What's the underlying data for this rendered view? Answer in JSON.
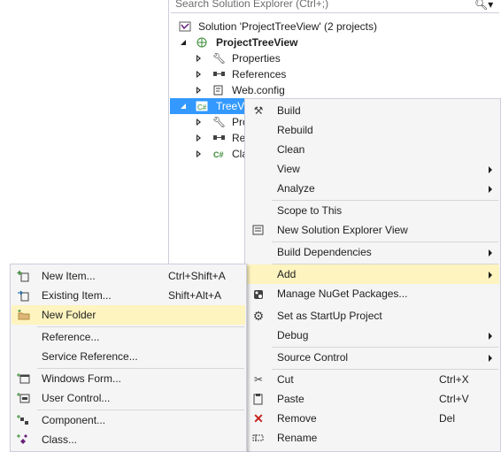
{
  "search": {
    "placeholder": "Search Solution Explorer (Ctrl+;)"
  },
  "tree": {
    "solution": "Solution 'ProjectTreeView' (2 projects)",
    "project": "ProjectTreeView",
    "items": [
      "Properties",
      "References",
      "Web.config"
    ],
    "selected": "TreeV",
    "sub_items": [
      "Pro",
      "Re",
      "Cla"
    ]
  },
  "context_menu": {
    "items": [
      {
        "label": "Build",
        "icon": "build-icon"
      },
      {
        "label": "Rebuild"
      },
      {
        "label": "Clean"
      },
      {
        "label": "View",
        "submenu": true
      },
      {
        "label": "Analyze",
        "submenu": true
      },
      {
        "label": "Scope to This"
      },
      {
        "label": "New Solution Explorer View",
        "icon": "new-view-icon"
      },
      {
        "label": "Build Dependencies",
        "submenu": true
      },
      {
        "label": "Add",
        "submenu": true,
        "highlighted": true
      },
      {
        "label": "Manage NuGet Packages...",
        "icon": "nuget-icon"
      },
      {
        "label": "Set as StartUp Project",
        "icon": "gear-icon"
      },
      {
        "label": "Debug",
        "submenu": true
      },
      {
        "label": "Source Control",
        "submenu": true
      },
      {
        "label": "Cut",
        "shortcut": "Ctrl+X",
        "icon": "scissors-icon"
      },
      {
        "label": "Paste",
        "shortcut": "Ctrl+V",
        "icon": "paste-icon"
      },
      {
        "label": "Remove",
        "shortcut": "Del",
        "icon": "remove-icon"
      },
      {
        "label": "Rename",
        "icon": "rename-icon"
      }
    ]
  },
  "add_submenu": {
    "items": [
      {
        "label": "New Item...",
        "shortcut": "Ctrl+Shift+A",
        "icon": "new-item-icon"
      },
      {
        "label": "Existing Item...",
        "shortcut": "Shift+Alt+A",
        "icon": "existing-item-icon"
      },
      {
        "label": "New Folder",
        "icon": "folder-icon",
        "highlighted": true
      },
      {
        "label": "Reference..."
      },
      {
        "label": "Service Reference..."
      },
      {
        "label": "Windows Form...",
        "icon": "windows-form-icon"
      },
      {
        "label": "User Control...",
        "icon": "user-control-icon"
      },
      {
        "label": "Component...",
        "icon": "component-icon"
      },
      {
        "label": "Class...",
        "icon": "class-icon"
      }
    ]
  },
  "colors": {
    "selection": "#3399ff",
    "highlight": "#fdf4bf",
    "menu_bg": "#f5f5f5"
  }
}
